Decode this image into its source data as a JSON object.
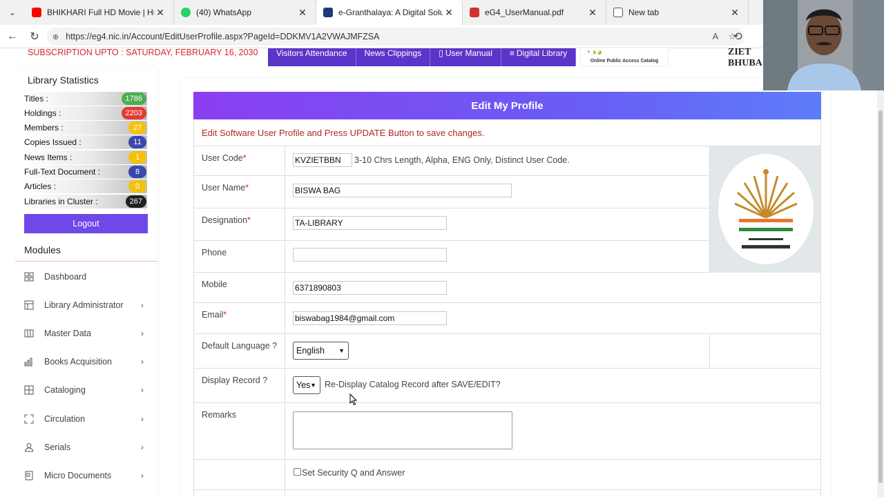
{
  "browser": {
    "tabs": [
      {
        "title": "BHIKHARI Full HD Movie | Hrithik",
        "favicon_color": "#ff0000",
        "active": false
      },
      {
        "title": "(40) WhatsApp",
        "favicon_color": "#25d366",
        "active": false
      },
      {
        "title": "e-Granthalaya: A Digital Solution",
        "favicon_color": "#1a3a7a",
        "active": true
      },
      {
        "title": "eG4_UserManual.pdf",
        "favicon_color": "#d32f2f",
        "active": false
      },
      {
        "title": "New tab",
        "favicon_color": "#555555",
        "active": false
      }
    ],
    "url": "https://eg4.nic.in/Account/EditUserProfile.aspx?PageId=DDKMV1A2VWAJMFZSA"
  },
  "site": {
    "subscription": "SUBSCRIPTION UPTO : SATURDAY, FEBRUARY 16, 2030",
    "topnav": [
      "Visitors Attendance",
      "News Clippings",
      "User Manual",
      "Digital Library"
    ],
    "opac_caption": "Online Public Access Catalog",
    "ziet_line1": "ZIET",
    "ziet_line2": "BHUBA"
  },
  "sidebar": {
    "stats_title": "Library Statistics",
    "stats": [
      {
        "label": "Titles :",
        "value": "1786",
        "color": "#4caf50"
      },
      {
        "label": "Holdings :",
        "value": "2203",
        "color": "#e53935"
      },
      {
        "label": "Members :",
        "value": "27",
        "color": "#f4c20d"
      },
      {
        "label": "Copies Issued :",
        "value": "11",
        "color": "#3949ab"
      },
      {
        "label": "News Items :",
        "value": "1",
        "color": "#f4c20d"
      },
      {
        "label": "Full-Text Document :",
        "value": "8",
        "color": "#3949ab"
      },
      {
        "label": "Articles :",
        "value": "0",
        "color": "#f4c20d"
      },
      {
        "label": "Libraries in Cluster :",
        "value": "267",
        "color": "#212121"
      }
    ],
    "logout_label": "Logout",
    "modules_title": "Modules",
    "modules": [
      {
        "label": "Dashboard",
        "icon": "dashboard-icon",
        "has_chevron": false
      },
      {
        "label": "Library Administrator",
        "icon": "table-icon",
        "has_chevron": true
      },
      {
        "label": "Master Data",
        "icon": "columns-icon",
        "has_chevron": true
      },
      {
        "label": "Books Acquisition",
        "icon": "bar-chart-icon",
        "has_chevron": true
      },
      {
        "label": "Cataloging",
        "icon": "grid-icon",
        "has_chevron": true
      },
      {
        "label": "Circulation",
        "icon": "expand-icon",
        "has_chevron": true
      },
      {
        "label": "Serials",
        "icon": "user-icon",
        "has_chevron": true
      },
      {
        "label": "Micro Documents",
        "icon": "document-icon",
        "has_chevron": true
      }
    ]
  },
  "form": {
    "title": "Edit My Profile",
    "subtitle": "Edit Software User Profile and Press UPDATE Button to save changes.",
    "user_code_label": "User Code",
    "user_code_value": "KVZIETBBN",
    "user_code_hint": "3-10 Chrs Length, Alpha, ENG Only, Distinct User Code.",
    "user_name_label": "User Name",
    "user_name_value": "BISWA BAG",
    "designation_label": "Designation",
    "designation_value": "TA-LIBRARY",
    "phone_label": "Phone",
    "phone_value": "",
    "mobile_label": "Mobile",
    "mobile_value": "6371890803",
    "email_label": "Email",
    "email_value": "biswabag1984@gmail.com",
    "language_label": "Default Language ?",
    "language_value": "English",
    "display_label": "Display Record ?",
    "display_value": "Yes",
    "display_hint": "Re-Display Catalog Record after SAVE/EDIT?",
    "remarks_label": "Remarks",
    "security_label": "Set Security Q and Answer",
    "required_mark": "*"
  },
  "colors": {
    "accent_purple": "#5b35c9",
    "header_gradient_start": "#8a3ef0",
    "header_gradient_end": "#5d7cf8",
    "subscription_red": "#d6262a"
  }
}
